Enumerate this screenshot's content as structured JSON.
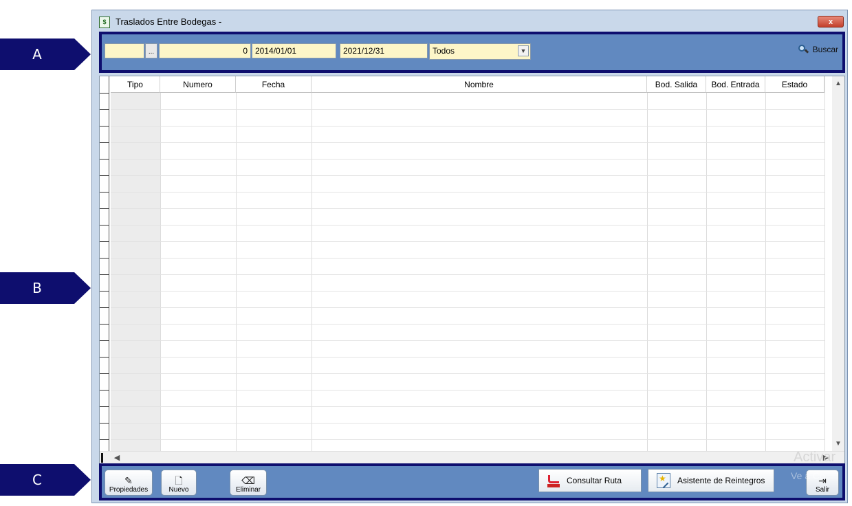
{
  "callouts": {
    "a": "A",
    "b": "B",
    "c": "C"
  },
  "window": {
    "title": "Traslados Entre Bodegas -",
    "close_label": "x"
  },
  "filters": {
    "code_value": "",
    "dots_label": "...",
    "number_value": "0",
    "date_from": "2014/01/01",
    "date_to": "2021/12/31",
    "status_selected": "Todos",
    "search_label": "Buscar"
  },
  "grid": {
    "columns": [
      "Tipo",
      "Numero",
      "Fecha",
      "Nombre",
      "Bod. Salida",
      "Bod. Entrada",
      "Estado"
    ],
    "rows": []
  },
  "bottom_toolbar": {
    "properties_label": "Propiedades",
    "new_label": "Nuevo",
    "delete_label": "Eliminar",
    "route_label": "Consultar Ruta",
    "refund_label": "Asistente de Reintegros",
    "exit_label": "Salir"
  },
  "watermark": {
    "line1": "Activar",
    "line2": "Ve a Co"
  },
  "colors": {
    "callout": "#0e0e6e",
    "toolbar": "#6189c0",
    "field": "#fdf6c8",
    "frame": "#c9d8ea"
  }
}
